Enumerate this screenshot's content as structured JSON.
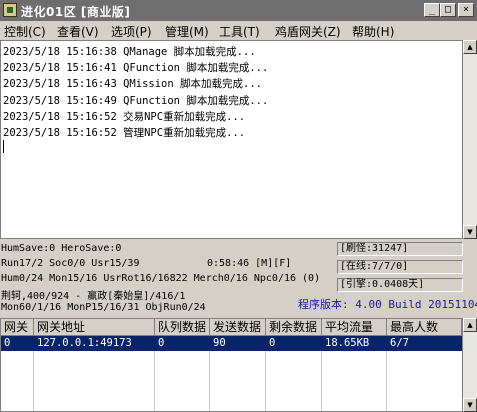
{
  "window": {
    "title": "进化01区 [商业版]",
    "buttons": {
      "minimize": "_",
      "maximize": "□",
      "close": "×"
    }
  },
  "menu": [
    "控制(C)",
    "查看(V)",
    "选项(P)",
    "管理(M)",
    "工具(T)",
    "鸡盾网关(Z)",
    "帮助(H)"
  ],
  "log": [
    "2023/5/18 15:16:38 QManage 脚本加载完成...",
    "2023/5/18 15:16:41 QFunction 脚本加载完成...",
    "2023/5/18 15:16:43 QMission 脚本加载完成...",
    "2023/5/18 15:16:49 QFunction 脚本加载完成...",
    "2023/5/18 15:16:52 交易NPC重新加载完成...",
    "2023/5/18 15:16:52 管理NPC重新加载完成..."
  ],
  "status": {
    "line1": "HumSave:0 HeroSave:0",
    "line2a": "Run17/2 Soc0/0 Usr15/39",
    "line2b": "0:58:46 [M][F]",
    "line3": "Hum0/24 Mon15/16 UsrRot16/16822 Merch0/16 Npc0/16 (0)",
    "line4": "荆轲,400/924 - 嬴政[秦始皇]/416/1",
    "line5": "Mon60/1/16 MonP15/16/31 ObjRun0/24",
    "refresh": "[刷怪:31247]",
    "online": "[在线:7/7/0]",
    "engine": "[引擎:0.0408天]",
    "version": "程序版本: 4.00 Build 20151104"
  },
  "table": {
    "columns": [
      "网关",
      "网关地址",
      "队列数据",
      "发送数据",
      "剩余数据",
      "平均流量",
      "最高人数"
    ],
    "rows": [
      [
        "0",
        "127.0.0.1:49173",
        "0",
        "90",
        "0",
        "18.65KB",
        "6/7"
      ]
    ]
  },
  "colors": {
    "titlebar": "#6e6e6e",
    "selection": "#0a246a",
    "version_text": "#1a1aa0"
  }
}
